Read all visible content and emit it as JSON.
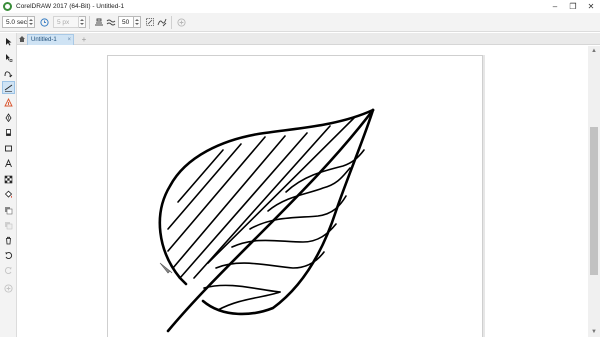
{
  "window": {
    "title": "CorelDRAW 2017 (64-Bit) - Untitled-1",
    "minimize_glyph": "–",
    "restore_glyph": "❐",
    "close_glyph": "✕"
  },
  "property_bar": {
    "duration_value": "5.0 sec",
    "nib_size_value": "5 px",
    "smoothing_value": "50",
    "icons": [
      "clock-icon",
      "nib-size-icon",
      "pressure-icon",
      "smoothing-icon",
      "bounding-box-icon",
      "freehand-icon",
      "add-icon"
    ]
  },
  "document_tab": {
    "label": "Untitled-1",
    "close_glyph": "×",
    "new_tab_glyph": "+"
  },
  "toolbox": {
    "tools": [
      "pick-tool-icon",
      "shape-tool-icon",
      "freehand-tool-icon",
      "live-sketch-tool-icon",
      "artistic-media-tool-icon",
      "pen-tool-icon",
      "eraser-tool-icon",
      "rectangle-tool-icon",
      "text-tool-icon",
      "pattern-tool-icon",
      "fill-tool-icon",
      "transparency-tool-icon",
      "interactive-tool-icon",
      "delete-tool-icon",
      "undo-tool-icon",
      "redo-tool-icon",
      "add-tool-icon"
    ],
    "active_tool": "live-sketch-tool-icon"
  },
  "colors": {
    "accent": "#cfe3f4",
    "stroke": "#000000",
    "ui_background": "#f3f3f3"
  }
}
